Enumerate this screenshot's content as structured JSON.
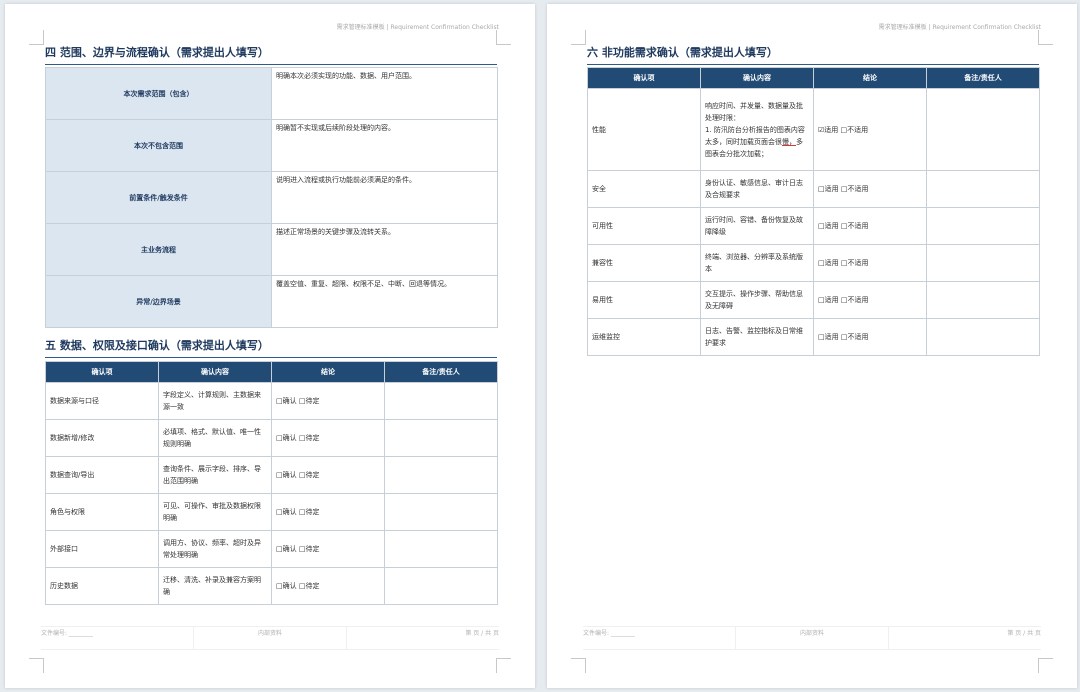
{
  "header_text": "需求管理标准模板 | Requirement Confirmation Checklist",
  "footer": {
    "doc_no": "文件编号: ________",
    "internal": "内部资料",
    "page": "第 页 / 共 页"
  },
  "section4": {
    "title": "四 范围、边界与流程确认（需求提出人填写）",
    "rows": [
      {
        "label": "本次需求范围（包含）",
        "desc": "明确本次必须实现的功能、数据、用户范围。"
      },
      {
        "label": "本次不包含范围",
        "desc": "明确暂不实现或后续阶段处理的内容。"
      },
      {
        "label": "前置条件/触发条件",
        "desc": "说明进入流程或执行功能前必须满足的条件。"
      },
      {
        "label": "主业务流程",
        "desc": "描述正常场景的关键步骤及流转关系。"
      },
      {
        "label": "异常/边界场景",
        "desc": "覆盖空值、重复、超限、权限不足、中断、回退等情况。"
      }
    ]
  },
  "section5": {
    "title": "五 数据、权限及接口确认（需求提出人填写）",
    "headers": [
      "确认项",
      "确认内容",
      "结论",
      "备注/责任人"
    ],
    "rows": [
      {
        "item": "数据来源与口径",
        "content": "字段定义、计算规则、主数据来源一致",
        "conclusion": "□确认 □待定",
        "remark": ""
      },
      {
        "item": "数据新增/修改",
        "content": "必填项、格式、默认值、唯一性规则明确",
        "conclusion": "□确认 □待定",
        "remark": ""
      },
      {
        "item": "数据查询/导出",
        "content": "查询条件、展示字段、排序、导出范围明确",
        "conclusion": "□确认 □待定",
        "remark": ""
      },
      {
        "item": "角色与权限",
        "content": "可见、可操作、审批及数据权限明确",
        "conclusion": "□确认 □待定",
        "remark": ""
      },
      {
        "item": "外部接口",
        "content": "调用方、协议、频率、超时及异常处理明确",
        "conclusion": "□确认 □待定",
        "remark": ""
      },
      {
        "item": "历史数据",
        "content": "迁移、清洗、补录及兼容方案明确",
        "conclusion": "□确认 □待定",
        "remark": ""
      }
    ]
  },
  "section6": {
    "title": "六 非功能需求确认（需求提出人填写）",
    "headers": [
      "确认项",
      "确认内容",
      "结论",
      "备注/责任人"
    ],
    "rows": [
      {
        "item": "性能",
        "content_a": "响应时间、并发量、数据量及批处理时限：",
        "content_b": "1. 防汛防台分析报告的图表内容太多，同时加载页面会很",
        "content_u": "慢，",
        "content_c": "多图表会分批次加载；",
        "conclusion": "☑适用 □不适用",
        "remark": ""
      },
      {
        "item": "安全",
        "content": "身份认证、敏感信息、审计日志及合规要求",
        "conclusion": "□适用 □不适用",
        "remark": ""
      },
      {
        "item": "可用性",
        "content": "运行时间、容错、备份恢复及故障降级",
        "conclusion": "□适用 □不适用",
        "remark": ""
      },
      {
        "item": "兼容性",
        "content": "终端、浏览器、分辨率及系统版本",
        "conclusion": "□适用 □不适用",
        "remark": ""
      },
      {
        "item": "易用性",
        "content": "交互提示、操作步骤、帮助信息及无障碍",
        "conclusion": "□适用 □不适用",
        "remark": ""
      },
      {
        "item": "运维监控",
        "content": "日志、告警、监控指标及日常维护要求",
        "conclusion": "□适用 □不适用",
        "remark": ""
      }
    ]
  }
}
